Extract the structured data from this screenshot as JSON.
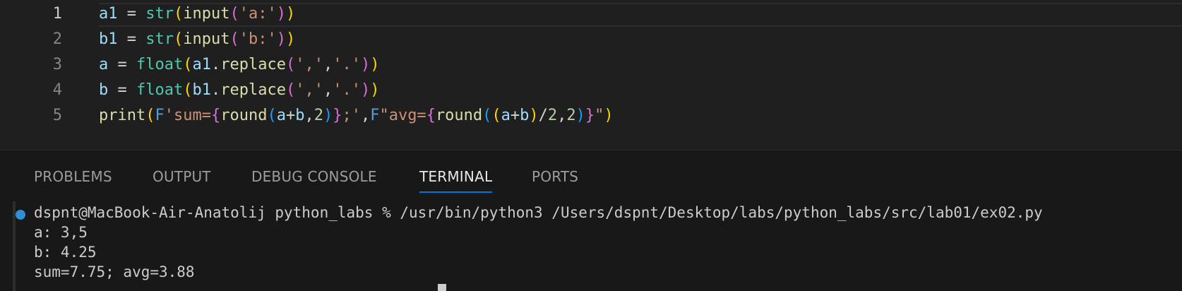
{
  "editor": {
    "lines": [
      {
        "number": "1",
        "tokens": [
          {
            "text": "a1",
            "type": "var"
          },
          {
            "text": " = ",
            "type": "op"
          },
          {
            "text": "str",
            "type": "cls"
          },
          {
            "text": "(",
            "type": "b1"
          },
          {
            "text": "input",
            "type": "fn"
          },
          {
            "text": "(",
            "type": "b2"
          },
          {
            "text": "'a:'",
            "type": "str"
          },
          {
            "text": ")",
            "type": "b2"
          },
          {
            "text": ")",
            "type": "b1"
          }
        ]
      },
      {
        "number": "2",
        "tokens": [
          {
            "text": "b1",
            "type": "var"
          },
          {
            "text": " = ",
            "type": "op"
          },
          {
            "text": "str",
            "type": "cls"
          },
          {
            "text": "(",
            "type": "b1"
          },
          {
            "text": "input",
            "type": "fn"
          },
          {
            "text": "(",
            "type": "b2"
          },
          {
            "text": "'b:'",
            "type": "str"
          },
          {
            "text": ")",
            "type": "b2"
          },
          {
            "text": ")",
            "type": "b1"
          }
        ]
      },
      {
        "number": "3",
        "tokens": [
          {
            "text": "a",
            "type": "var"
          },
          {
            "text": " = ",
            "type": "op"
          },
          {
            "text": "float",
            "type": "cls"
          },
          {
            "text": "(",
            "type": "b1"
          },
          {
            "text": "a1",
            "type": "var"
          },
          {
            "text": ".",
            "type": "op"
          },
          {
            "text": "replace",
            "type": "fn"
          },
          {
            "text": "(",
            "type": "b2"
          },
          {
            "text": "','",
            "type": "str"
          },
          {
            "text": ",",
            "type": "op"
          },
          {
            "text": "'.'",
            "type": "str"
          },
          {
            "text": ")",
            "type": "b2"
          },
          {
            "text": ")",
            "type": "b1"
          }
        ]
      },
      {
        "number": "4",
        "tokens": [
          {
            "text": "b",
            "type": "var"
          },
          {
            "text": " = ",
            "type": "op"
          },
          {
            "text": "float",
            "type": "cls"
          },
          {
            "text": "(",
            "type": "b1"
          },
          {
            "text": "b1",
            "type": "var"
          },
          {
            "text": ".",
            "type": "op"
          },
          {
            "text": "replace",
            "type": "fn"
          },
          {
            "text": "(",
            "type": "b2"
          },
          {
            "text": "','",
            "type": "str"
          },
          {
            "text": ",",
            "type": "op"
          },
          {
            "text": "'.'",
            "type": "str"
          },
          {
            "text": ")",
            "type": "b2"
          },
          {
            "text": ")",
            "type": "b1"
          }
        ]
      },
      {
        "number": "5",
        "tokens": [
          {
            "text": "print",
            "type": "fn"
          },
          {
            "text": "(",
            "type": "b1"
          },
          {
            "text": "F",
            "type": "kw"
          },
          {
            "text": "'sum=",
            "type": "str"
          },
          {
            "text": "{",
            "type": "b2"
          },
          {
            "text": "round",
            "type": "fn"
          },
          {
            "text": "(",
            "type": "b3"
          },
          {
            "text": "a",
            "type": "var"
          },
          {
            "text": "+",
            "type": "op"
          },
          {
            "text": "b",
            "type": "var"
          },
          {
            "text": ",",
            "type": "op"
          },
          {
            "text": "2",
            "type": "num"
          },
          {
            "text": ")",
            "type": "b3"
          },
          {
            "text": "}",
            "type": "b2"
          },
          {
            "text": ";'",
            "type": "str"
          },
          {
            "text": ",",
            "type": "op"
          },
          {
            "text": "F",
            "type": "kw"
          },
          {
            "text": "\"avg=",
            "type": "str"
          },
          {
            "text": "{",
            "type": "b2"
          },
          {
            "text": "round",
            "type": "fn"
          },
          {
            "text": "(",
            "type": "b3"
          },
          {
            "text": "(",
            "type": "b1"
          },
          {
            "text": "a",
            "type": "var"
          },
          {
            "text": "+",
            "type": "op"
          },
          {
            "text": "b",
            "type": "var"
          },
          {
            "text": ")",
            "type": "b1"
          },
          {
            "text": "/",
            "type": "op"
          },
          {
            "text": "2",
            "type": "num"
          },
          {
            "text": ",",
            "type": "op"
          },
          {
            "text": "2",
            "type": "num"
          },
          {
            "text": ")",
            "type": "b3"
          },
          {
            "text": "}",
            "type": "b2"
          },
          {
            "text": "\"",
            "type": "str"
          },
          {
            "text": ")",
            "type": "b1"
          }
        ]
      }
    ]
  },
  "panel": {
    "tabs": [
      {
        "label": "PROBLEMS",
        "active": false
      },
      {
        "label": "OUTPUT",
        "active": false
      },
      {
        "label": "DEBUG CONSOLE",
        "active": false
      },
      {
        "label": "TERMINAL",
        "active": true
      },
      {
        "label": "PORTS",
        "active": false
      }
    ]
  },
  "terminal": {
    "lines": [
      "dspnt@MacBook-Air-Anatolij python_labs % /usr/bin/python3 /Users/dspnt/Desktop/labs/python_labs/src/lab01/ex02.py",
      "a: 3,5",
      "b: 4.25",
      "sum=7.75; avg=3.88"
    ],
    "decoration_color": "#2f8fd6"
  }
}
